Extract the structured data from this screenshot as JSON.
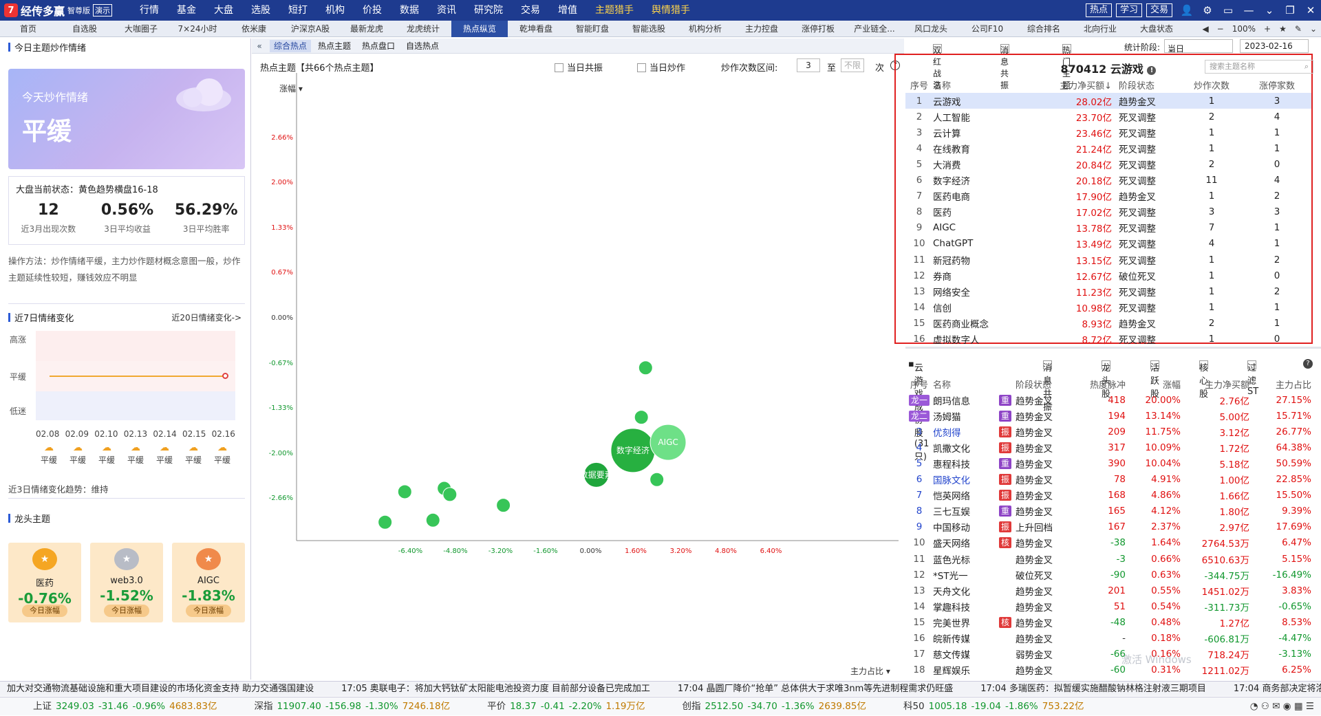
{
  "app": {
    "name": "经传多赢",
    "edition": "智尊版",
    "demo": "演示"
  },
  "top_menu": [
    "行情",
    "基金",
    "大盘",
    "选股",
    "短打",
    "机构",
    "价投",
    "数据",
    "资讯",
    "研究院",
    "交易",
    "增值",
    "主题猎手",
    "舆情猎手"
  ],
  "top_right": {
    "hot": "热点",
    "learn": "学习",
    "exchange": "交易"
  },
  "tabs": [
    "首页",
    "自选股",
    "大咖圈子",
    "7×24小时",
    "依米康",
    "沪深京A股",
    "最新龙虎",
    "龙虎统计",
    "热点纵览",
    "乾坤看盘",
    "智能盯盘",
    "智能选股",
    "机构分析",
    "主力控盘",
    "涨停打板",
    "产业链全...",
    "风口龙头",
    "公司F10",
    "综合排名",
    "北向行业",
    "大盘状态"
  ],
  "tabs_active": "热点纵览",
  "tabs_zoom": "100%",
  "left": {
    "section1_title": "今日主题炒作情绪",
    "hero_caption": "今天炒作情绪",
    "hero_value": "平缓",
    "market_state": "大盘当前状态：黄色趋势横盘16-18",
    "stats": [
      {
        "value": "12",
        "label": "近3月出现次数"
      },
      {
        "value": "0.56%",
        "label": "3日平均收益"
      },
      {
        "value": "56.29%",
        "label": "3日平均胜率"
      }
    ],
    "op_hint": "操作方法：炒作情绪平缓，主力炒作题材概念意图一般，炒作主题延续性较短，赚钱效应不明显",
    "trend_title": "近7日情绪变化",
    "trend_more": "近20日情绪变化->",
    "trend_levels": [
      "高涨",
      "平缓",
      "低迷"
    ],
    "trend_dates": [
      "02.08",
      "02.09",
      "02.10",
      "02.13",
      "02.14",
      "02.15",
      "02.16"
    ],
    "trend_states": [
      "平缓",
      "平缓",
      "平缓",
      "平缓",
      "平缓",
      "平缓",
      "平缓"
    ],
    "trend_note": "近3日情绪变化趋势：维持",
    "leader_title": "龙头主题",
    "leaders": [
      {
        "name": "医药",
        "pct": "-0.76%",
        "btn": "今日涨幅",
        "medal": "gold"
      },
      {
        "name": "web3.0",
        "pct": "-1.52%",
        "btn": "今日涨幅",
        "medal": "silver"
      },
      {
        "name": "AIGC",
        "pct": "-1.83%",
        "btn": "今日涨幅",
        "medal": "bronze"
      }
    ]
  },
  "middle": {
    "subtabs": [
      "综合热点",
      "热点主题",
      "热点盘口",
      "自选热点"
    ],
    "chart_title": "热点主题【共66个热点主题】",
    "opt1": "当日共振",
    "opt2": "当日炒作",
    "range_label": "炒作次数区间:",
    "range_from": "3",
    "range_to_label": "至",
    "range_to": "不限",
    "range_unit": "次",
    "y_selector": "涨幅",
    "x_selector": "主力占比",
    "chart_data": {
      "type": "scatter",
      "xlabel": "主力占比",
      "ylabel": "涨幅",
      "x_ticks": [
        "-6.40%",
        "-4.80%",
        "-3.20%",
        "-1.60%",
        "0.00%",
        "1.60%",
        "3.20%",
        "4.80%",
        "6.40%"
      ],
      "y_ticks": [
        "2.66%",
        "2.00%",
        "1.33%",
        "0.67%",
        "0.00%",
        "-0.67%",
        "-1.33%",
        "-2.00%",
        "-2.66%"
      ],
      "xlim": [
        -8.0,
        8.0
      ],
      "ylim": [
        -3.2,
        3.3
      ],
      "points": [
        {
          "x": 1.95,
          "y": -0.75,
          "r": 1,
          "label": ""
        },
        {
          "x": 1.8,
          "y": -1.48,
          "r": 1,
          "label": ""
        },
        {
          "x": 1.5,
          "y": -1.97,
          "r": 3.2,
          "label": "数字经济",
          "color": "#27b040"
        },
        {
          "x": 2.75,
          "y": -1.85,
          "r": 2.6,
          "label": "AIGC",
          "color": "#6ee087"
        },
        {
          "x": 0.2,
          "y": -2.33,
          "r": 1.8,
          "label": "数据要素",
          "color": "#1fa63c"
        },
        {
          "x": 2.35,
          "y": -2.4,
          "r": 1,
          "label": ""
        },
        {
          "x": -6.6,
          "y": -2.58,
          "r": 1,
          "label": ""
        },
        {
          "x": -5.2,
          "y": -2.53,
          "r": 1,
          "label": ""
        },
        {
          "x": -5.0,
          "y": -2.62,
          "r": 1,
          "label": ""
        },
        {
          "x": -3.1,
          "y": -2.78,
          "r": 1,
          "label": ""
        },
        {
          "x": -7.3,
          "y": -3.03,
          "r": 1,
          "label": ""
        },
        {
          "x": -5.6,
          "y": -3.0,
          "r": 1,
          "label": ""
        }
      ]
    }
  },
  "right": {
    "filters": [
      "双红战法",
      "消息共振",
      "热门主题"
    ],
    "stage_label": "统计阶段:",
    "stage_value": "当日",
    "date": "2023-02-16",
    "detail_title": "870412 云游戏",
    "search_placeholder": "搜索主题名称",
    "table_headers": [
      "序号",
      "名称",
      "主力净买额↓",
      "阶段状态",
      "炒作次数",
      "涨停家数"
    ],
    "rows": [
      [
        "1",
        "云游戏",
        "28.02亿",
        "趋势金叉",
        "1",
        "3"
      ],
      [
        "2",
        "人工智能",
        "23.70亿",
        "死叉调整",
        "2",
        "4"
      ],
      [
        "3",
        "云计算",
        "23.46亿",
        "死叉调整",
        "1",
        "1"
      ],
      [
        "4",
        "在线教育",
        "21.24亿",
        "死叉调整",
        "1",
        "1"
      ],
      [
        "5",
        "大消费",
        "20.84亿",
        "死叉调整",
        "2",
        "0"
      ],
      [
        "6",
        "数字经济",
        "20.18亿",
        "死叉调整",
        "11",
        "4"
      ],
      [
        "7",
        "医药电商",
        "17.90亿",
        "趋势金叉",
        "1",
        "2"
      ],
      [
        "8",
        "医药",
        "17.02亿",
        "死叉调整",
        "3",
        "3"
      ],
      [
        "9",
        "AIGC",
        "13.78亿",
        "死叉调整",
        "7",
        "1"
      ],
      [
        "10",
        "ChatGPT",
        "13.49亿",
        "死叉调整",
        "4",
        "1"
      ],
      [
        "11",
        "新冠药物",
        "13.15亿",
        "死叉调整",
        "1",
        "2"
      ],
      [
        "12",
        "券商",
        "12.67亿",
        "破位死叉",
        "1",
        "0"
      ],
      [
        "13",
        "网络安全",
        "11.23亿",
        "死叉调整",
        "1",
        "2"
      ],
      [
        "14",
        "信创",
        "10.98亿",
        "死叉调整",
        "1",
        "1"
      ],
      [
        "15",
        "医药商业概念",
        "8.93亿",
        "趋势金叉",
        "2",
        "1"
      ],
      [
        "16",
        "虚拟数字人",
        "8.72亿",
        "死叉调整",
        "1",
        "0"
      ]
    ],
    "stocks_title": "云游戏成份股(31只)",
    "stock_filters": [
      "消息共振",
      "龙头股",
      "活跃股",
      "核心股",
      "过滤ST"
    ],
    "stock_headers": [
      "序号",
      "名称",
      "",
      "阶段状态",
      "热度脉冲",
      "涨幅",
      "主力净买额",
      "主力占比"
    ],
    "stocks": [
      [
        "龙一",
        "朗玛信息",
        "重",
        "趋势金叉",
        "418",
        "20.00%",
        "2.76亿",
        "27.15%"
      ],
      [
        "龙二",
        "汤姆猫",
        "重",
        "趋势金叉",
        "194",
        "13.14%",
        "5.00亿",
        "15.71%"
      ],
      [
        "3",
        "优刻得",
        "振",
        "趋势金叉",
        "209",
        "11.75%",
        "3.12亿",
        "26.77%"
      ],
      [
        "4",
        "凯撒文化",
        "振",
        "趋势金叉",
        "317",
        "10.09%",
        "1.72亿",
        "64.38%"
      ],
      [
        "5",
        "惠程科技",
        "重",
        "趋势金叉",
        "390",
        "10.04%",
        "5.18亿",
        "50.59%"
      ],
      [
        "6",
        "国脉文化",
        "振",
        "趋势金叉",
        "78",
        "4.91%",
        "1.00亿",
        "22.85%"
      ],
      [
        "7",
        "恺英网络",
        "振",
        "趋势金叉",
        "168",
        "4.86%",
        "1.66亿",
        "15.50%"
      ],
      [
        "8",
        "三七互娱",
        "重",
        "趋势金叉",
        "165",
        "4.12%",
        "1.80亿",
        "9.39%"
      ],
      [
        "9",
        "中国移动",
        "振",
        "上升回档",
        "167",
        "2.37%",
        "2.97亿",
        "17.69%"
      ],
      [
        "10",
        "盛天网络",
        "核",
        "趋势金叉",
        "-38",
        "1.64%",
        "2764.53万",
        "6.47%"
      ],
      [
        "11",
        "蓝色光标",
        "",
        "趋势金叉",
        "-3",
        "0.66%",
        "6510.63万",
        "5.15%"
      ],
      [
        "12",
        "*ST光一",
        "",
        "破位死叉",
        "-90",
        "0.63%",
        "-344.75万",
        "-16.49%"
      ],
      [
        "13",
        "天舟文化",
        "",
        "趋势金叉",
        "201",
        "0.55%",
        "1451.02万",
        "3.83%"
      ],
      [
        "14",
        "掌趣科技",
        "",
        "趋势金叉",
        "51",
        "0.54%",
        "-311.73万",
        "-0.65%"
      ],
      [
        "15",
        "完美世界",
        "核",
        "趋势金叉",
        "-48",
        "0.48%",
        "1.27亿",
        "8.53%"
      ],
      [
        "16",
        "皖新传媒",
        "",
        "趋势金叉",
        "-",
        "0.18%",
        "-606.81万",
        "-4.47%"
      ],
      [
        "17",
        "慈文传媒",
        "",
        "弱势金叉",
        "-66",
        "0.16%",
        "718.24万",
        "-3.13%"
      ],
      [
        "18",
        "星辉娱乐",
        "",
        "趋势金叉",
        "-60",
        "0.31%",
        "1211.02万",
        "6.25%"
      ]
    ]
  },
  "ticker": [
    "加大对交通物流基础设施和重大项目建设的市场化资金支持 助力交通强国建设",
    "17:05 奥联电子：将加大钙钛矿太阳能电池投资力度 目前部分设备已完成加工",
    "17:04 晶圆厂降价“抢单” 总体供大于求唯3nm等先进制程需求仍旺盛",
    "17:04 多瑞医药：拟暂缓实施醋酸钠林格注射液三期项目",
    "17:04 商务部决定将洛克"
  ],
  "indices": [
    {
      "name": "上证",
      "value": "3249.03",
      "chg": "-31.46",
      "pct": "-0.96%",
      "amt": "4683.83亿"
    },
    {
      "name": "深指",
      "value": "11907.40",
      "chg": "-156.98",
      "pct": "-1.30%",
      "amt": "7246.18亿"
    },
    {
      "name": "平价",
      "value": "18.37",
      "chg": "-0.41",
      "pct": "-2.20%",
      "amt": "1.19万亿"
    },
    {
      "name": "创指",
      "value": "2512.50",
      "chg": "-34.70",
      "pct": "-1.36%",
      "amt": "2639.85亿"
    },
    {
      "name": "科50",
      "value": "1005.18",
      "chg": "-19.04",
      "pct": "-1.86%",
      "amt": "753.22亿"
    }
  ],
  "watermark": "激活 Windows"
}
